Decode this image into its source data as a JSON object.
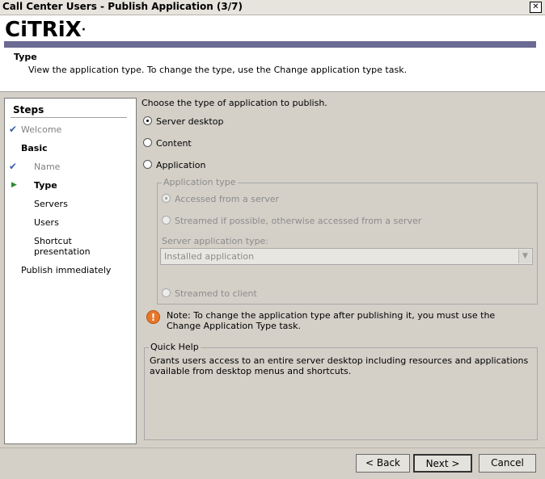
{
  "window": {
    "title": "Call Center Users - Publish Application (3/7)"
  },
  "header": {
    "logo_text": "CiTRiX",
    "section_title": "Type",
    "section_desc": "View the application type.  To change the type, use the Change application type task."
  },
  "steps": {
    "title": "Steps",
    "items": [
      {
        "label": "Welcome"
      },
      {
        "label": "Basic"
      },
      {
        "label": "Name"
      },
      {
        "label": "Type"
      },
      {
        "label": "Servers"
      },
      {
        "label": "Users"
      },
      {
        "label": "Shortcut\npresentation"
      },
      {
        "label": "Publish immediately"
      }
    ]
  },
  "content": {
    "prompt": "Choose the type of application to publish.",
    "options": {
      "server_desktop": "Server desktop",
      "content": "Content",
      "application": "Application"
    },
    "app_type": {
      "legend": "Application type",
      "accessed": "Accessed from a server",
      "streamed_if_possible": "Streamed if possible, otherwise accessed from a server",
      "server_app_type_label": "Server application type:",
      "server_app_type_value": "Installed application",
      "streamed_to_client": "Streamed to client"
    },
    "note": "Note: To change the application type after publishing it, you must use the Change Application Type task.",
    "quick_help": {
      "legend": "Quick Help",
      "text": "Grants users access to an entire server desktop including resources and applications available from desktop menus and shortcuts."
    }
  },
  "buttons": {
    "back": "< Back",
    "next": "Next >",
    "cancel": "Cancel"
  }
}
